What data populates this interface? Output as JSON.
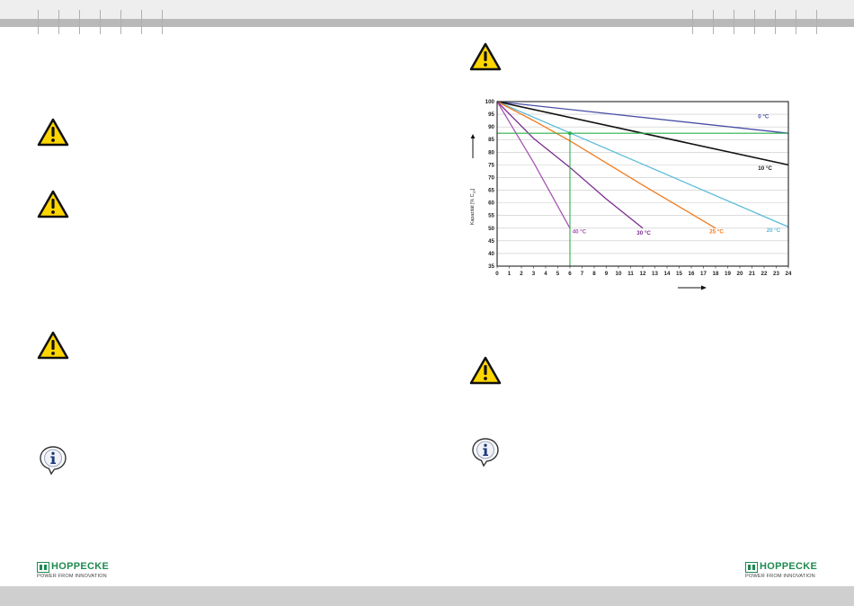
{
  "header": {
    "tick_marks": true
  },
  "brand": {
    "name": "HOPPECKE",
    "tagline": "POWER FROM INNOVATION",
    "color": "#1f8a50"
  },
  "icons": {
    "warning": "warning-triangle-icon",
    "info": "info-speech-bubble-icon",
    "warning_fill": "#ffd500"
  },
  "chart_data": {
    "type": "line",
    "title": "",
    "xlabel": "",
    "ylabel": "Kapazität [% C",
    "ylabel_sub": "10",
    "ylabel_end": "]",
    "xlim": [
      0,
      24
    ],
    "ylim": [
      35,
      100
    ],
    "xticks": [
      "0",
      "1",
      "2",
      "3",
      "4",
      "5",
      "6",
      "7",
      "8",
      "9",
      "10",
      "11",
      "12",
      "13",
      "14",
      "15",
      "16",
      "17",
      "18",
      "19",
      "20",
      "21",
      "22",
      "23",
      "24"
    ],
    "yticks": [
      "100",
      "95",
      "90",
      "85",
      "80",
      "75",
      "70",
      "65",
      "60",
      "55",
      "50",
      "45",
      "40",
      "35"
    ],
    "grid": true,
    "series": [
      {
        "name": "0 °C",
        "color": "#4a4fa6",
        "x": [
          0,
          24
        ],
        "y": [
          100,
          87.5
        ]
      },
      {
        "name": "10 °C",
        "color": "#111111",
        "x": [
          0,
          24
        ],
        "y": [
          100,
          75
        ]
      },
      {
        "name": "20 °C",
        "color": "#5bbcd8",
        "x": [
          0,
          24
        ],
        "y": [
          100,
          50.5
        ]
      },
      {
        "name": "25 °C",
        "color": "#f07a1e",
        "x": [
          0,
          3,
          6,
          12,
          18
        ],
        "y": [
          100,
          92.5,
          84.5,
          67,
          50
        ]
      },
      {
        "name": "30 °C",
        "color": "#7b2c8f",
        "x": [
          0,
          3,
          6,
          9,
          12
        ],
        "y": [
          100,
          85.5,
          74,
          61.5,
          50
        ]
      },
      {
        "name": "40 °C",
        "color": "#a855b5",
        "x": [
          0,
          1.5,
          3,
          4.5,
          6
        ],
        "y": [
          100,
          88,
          76,
          63,
          50
        ]
      }
    ],
    "annotations": [
      {
        "label": "0 °C",
        "x": 21.5,
        "y": 93.5
      },
      {
        "label": "10 °C",
        "x": 21.5,
        "y": 73
      },
      {
        "label": "20 °C",
        "x": 22.2,
        "y": 48.5
      },
      {
        "label": "25 °C",
        "x": 17.5,
        "y": 48
      },
      {
        "label": "30 °C",
        "x": 11.5,
        "y": 47.5
      },
      {
        "label": "40 °C",
        "x": 6.2,
        "y": 48
      }
    ],
    "reference": {
      "x": 6,
      "y": 87.5,
      "color": "#2db04b"
    }
  }
}
